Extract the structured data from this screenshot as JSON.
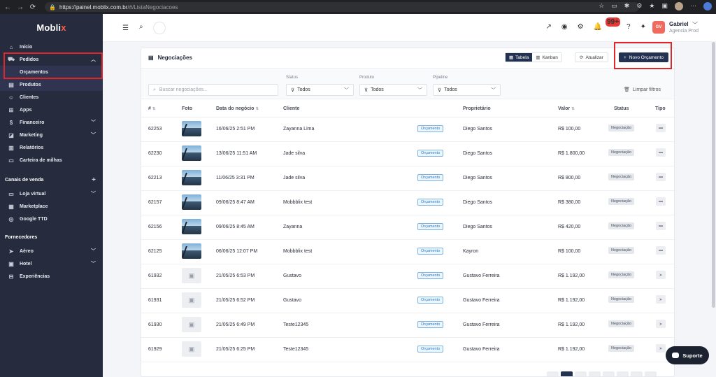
{
  "browser": {
    "url_host": "https://painel.moblix.com.br",
    "url_path": "/#/ListaNegociacoes"
  },
  "sidebar": {
    "logo": "Moblix",
    "items": [
      {
        "label": "Início",
        "icon": "home-icon"
      },
      {
        "label": "Pedidos",
        "icon": "cart-icon"
      },
      {
        "label": "Orçamentos",
        "icon": ""
      },
      {
        "label": "Produtos",
        "icon": "box-icon"
      },
      {
        "label": "Clientes",
        "icon": "users-icon"
      },
      {
        "label": "Apps",
        "icon": "grid-icon"
      },
      {
        "label": "Financeiro",
        "icon": "money-icon"
      },
      {
        "label": "Marketing",
        "icon": "megaphone-icon"
      },
      {
        "label": "Relatórios",
        "icon": "chart-icon"
      },
      {
        "label": "Carteira de milhas",
        "icon": "wallet-icon"
      }
    ],
    "group_sales": "Canais de venda",
    "sales_items": [
      {
        "label": "Loja virtual"
      },
      {
        "label": "Marketplace"
      },
      {
        "label": "Google TTD"
      }
    ],
    "group_suppliers": "Fornecedores",
    "supplier_items": [
      {
        "label": "Aéreo"
      },
      {
        "label": "Hotel"
      },
      {
        "label": "Experiências"
      }
    ]
  },
  "header": {
    "notif_badge": "99+",
    "user_initials": "GV",
    "user_name": "Gabriel",
    "user_role": "Agencia Prod"
  },
  "page": {
    "title": "Negociações",
    "view_table": "Tabela",
    "view_kanban": "Kanban",
    "refresh": "Atualizar",
    "new_quote": "Novo Orçamento",
    "search_placeholder": "Buscar negociações...",
    "filters": [
      {
        "label": "Status",
        "value": "Todos"
      },
      {
        "label": "Produto",
        "value": "Todos"
      },
      {
        "label": "Pipeline",
        "value": "Todos"
      }
    ],
    "clear_filters": "Limpar filtros"
  },
  "table": {
    "columns": [
      "#",
      "Foto",
      "Data do negócio",
      "Cliente",
      "Proprietário",
      "Valor",
      "Status",
      "Tipo"
    ],
    "rows": [
      {
        "id": "62253",
        "photo": true,
        "date": "16/06/25 2:51 PM",
        "client": "Zayanna Lima",
        "tag": "Orçamento",
        "owner": "Diego Santos",
        "value": "R$ 100,00",
        "status": "Negociação"
      },
      {
        "id": "62230",
        "photo": true,
        "date": "13/06/25 11:51 AM",
        "client": "Jade silva",
        "tag": "Orçamento",
        "owner": "Diego Santos",
        "value": "R$ 1.800,00",
        "status": "Negociação"
      },
      {
        "id": "62213",
        "photo": true,
        "date": "11/06/25 3:31 PM",
        "client": "Jade silva",
        "tag": "Orçamento",
        "owner": "Diego Santos",
        "value": "R$ 800,00",
        "status": "Negociação"
      },
      {
        "id": "62157",
        "photo": true,
        "date": "09/06/25 8:47 AM",
        "client": "Mobbblix test",
        "tag": "Orçamento",
        "owner": "Diego Santos",
        "value": "R$ 380,00",
        "status": "Negociação"
      },
      {
        "id": "62156",
        "photo": true,
        "date": "09/06/25 8:45 AM",
        "client": "Zayanna",
        "tag": "Orçamento",
        "owner": "Diego Santos",
        "value": "R$ 420,00",
        "status": "Negociação"
      },
      {
        "id": "62125",
        "photo": true,
        "date": "06/06/25 12:07 PM",
        "client": "Mobbblix test",
        "tag": "Orçamento",
        "owner": "Kayron",
        "value": "R$ 100,00",
        "status": "Negociação"
      },
      {
        "id": "61932",
        "photo": false,
        "date": "21/05/25 6:53 PM",
        "client": "Gustavo",
        "tag": "Orçamento",
        "owner": "Gustavo Ferreira",
        "value": "R$ 1.192,00",
        "status": "Negociação"
      },
      {
        "id": "61931",
        "photo": false,
        "date": "21/05/25 6:52 PM",
        "client": "Gustavo",
        "tag": "Orçamento",
        "owner": "Gustavo Ferreira",
        "value": "R$ 1.192,00",
        "status": "Negociação"
      },
      {
        "id": "61930",
        "photo": false,
        "date": "21/05/25 6:49 PM",
        "client": "Teste12345",
        "tag": "Orçamento",
        "owner": "Gustavo Ferreira",
        "value": "R$ 1.192,00",
        "status": "Negociação"
      },
      {
        "id": "61929",
        "photo": false,
        "date": "21/05/25 6:25 PM",
        "client": "Teste12345",
        "tag": "Orçamento",
        "owner": "Gustavo Ferreira",
        "value": "R$ 1.192,00",
        "status": "Negociação"
      }
    ]
  },
  "support": "Suporte",
  "colors": {
    "accent": "#243251",
    "sidebar": "#262b3d",
    "highlight": "#e0262b"
  }
}
